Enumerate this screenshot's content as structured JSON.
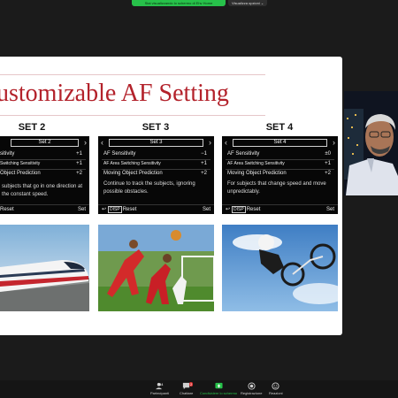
{
  "meeting": {
    "share_banner": "Stai visualizzando lo schermo di Ehv Home",
    "view_options": "Visualizza opzioni ⌄"
  },
  "slide": {
    "title": "ustomizable AF Setting",
    "sets": [
      {
        "heading": "SET 2",
        "screen": "Set 2",
        "rows": [
          {
            "label": "sitivity",
            "value": "+1"
          },
          {
            "label": "Switching Sensitivity",
            "value": "+1"
          },
          {
            "label": "Object Prediction",
            "value": "+2"
          }
        ],
        "description": "subjects that go in one direction at the constant speed.",
        "reset": "Reset",
        "set": "Set"
      },
      {
        "heading": "SET 3",
        "screen": "Set 3",
        "rows": [
          {
            "label": "AF Sensitivity",
            "value": "−1"
          },
          {
            "label": "AF Area Switching Sensitivity",
            "value": "+1"
          },
          {
            "label": "Moving Object Prediction",
            "value": "+2"
          }
        ],
        "description": "Continue to track the subjects, ignoring possible obstacles.",
        "disp": "DISP",
        "reset": "Reset",
        "set": "Set"
      },
      {
        "heading": "SET 4",
        "screen": "Set 4",
        "rows": [
          {
            "label": "AF Sensitivity",
            "value": "±0"
          },
          {
            "label": "AF Area Switching Sensitivity",
            "value": "+1"
          },
          {
            "label": "Moving Object Prediction",
            "value": "+2"
          }
        ],
        "description": "For subjects that change speed and move unpredictably.",
        "disp": "DISP",
        "reset": "Reset",
        "set": "Set"
      }
    ]
  },
  "toolbar": {
    "participants_count": "44",
    "participants_label": "Partecipanti",
    "chat_badge": "2",
    "chat_label": "Chattare",
    "share_label": "Condividere lo schermo",
    "record_label": "Registrazione",
    "reactions_label": "Reazioni"
  },
  "colors": {
    "title_red": "#b3222b",
    "share_green": "#27c14a",
    "panel_black": "#070707"
  }
}
